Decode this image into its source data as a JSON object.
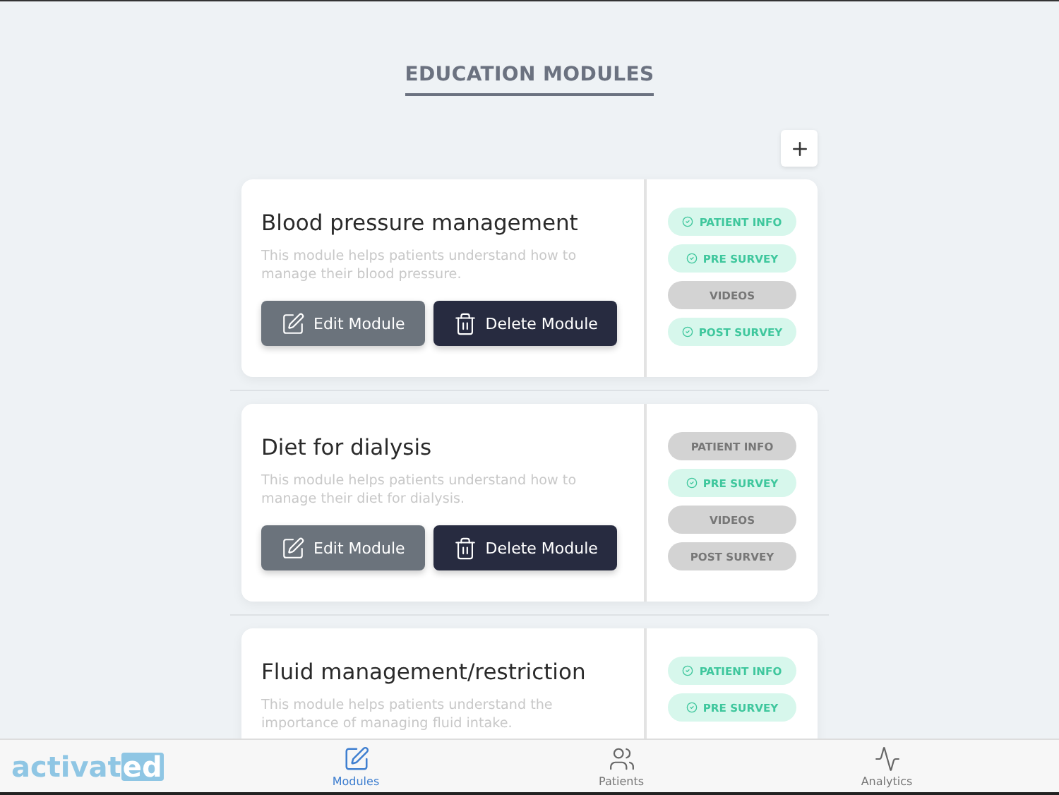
{
  "page": {
    "title": "EDUCATION MODULES"
  },
  "modules": [
    {
      "title": "Blood pressure management",
      "description": "This module helps patients understand how to manage their blood pressure.",
      "edit_button": "Edit Module",
      "delete_button": "Delete Module",
      "steps": [
        {
          "label": "PATIENT INFO",
          "completed": true
        },
        {
          "label": "PRE SURVEY",
          "completed": true
        },
        {
          "label": "VIDEOS",
          "completed": false
        },
        {
          "label": "POST SURVEY",
          "completed": true
        }
      ]
    },
    {
      "title": "Diet for dialysis",
      "description": "This module helps patients understand how to manage their diet for dialysis.",
      "edit_button": "Edit Module",
      "delete_button": "Delete Module",
      "steps": [
        {
          "label": "PATIENT INFO",
          "completed": false
        },
        {
          "label": "PRE SURVEY",
          "completed": true
        },
        {
          "label": "VIDEOS",
          "completed": false
        },
        {
          "label": "POST SURVEY",
          "completed": false
        }
      ]
    },
    {
      "title": "Fluid management/restriction",
      "description": "This module helps patients understand the importance of managing fluid intake.",
      "steps": [
        {
          "label": "PATIENT INFO",
          "completed": true
        },
        {
          "label": "PRE SURVEY",
          "completed": true
        }
      ]
    }
  ],
  "tab_bar": {
    "logo": {
      "text": "activat",
      "highlight": "ed"
    },
    "tabs": [
      {
        "label": "Modules",
        "selected": true
      },
      {
        "label": "Patients",
        "selected": false
      },
      {
        "label": "Analytics",
        "selected": false
      }
    ]
  }
}
